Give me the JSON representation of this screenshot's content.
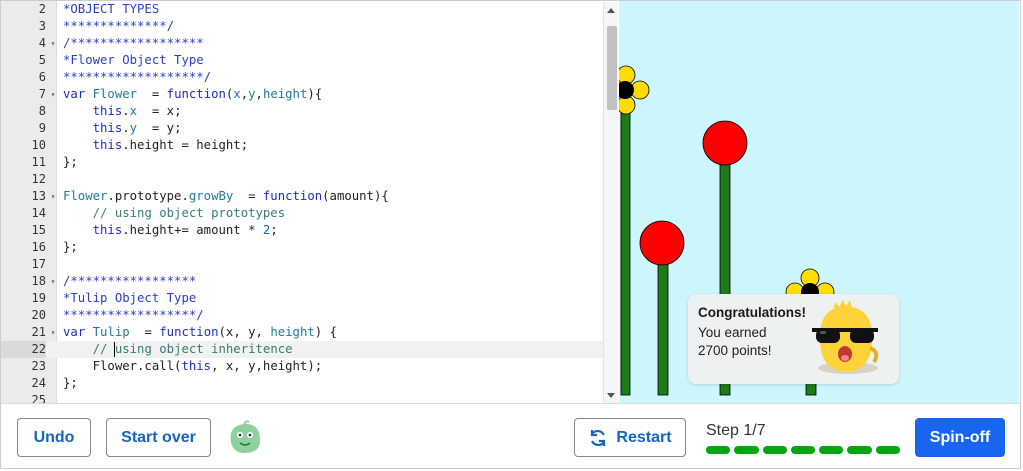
{
  "editor": {
    "lines": [
      {
        "n": "2",
        "fold": false,
        "active": false,
        "segs": [
          [
            "cmt",
            "*OBJECT TYPES"
          ]
        ]
      },
      {
        "n": "3",
        "fold": false,
        "active": false,
        "segs": [
          [
            "cmt",
            "**************/"
          ]
        ]
      },
      {
        "n": "4",
        "fold": true,
        "active": false,
        "segs": [
          [
            "cmt",
            "/******************"
          ]
        ]
      },
      {
        "n": "5",
        "fold": false,
        "active": false,
        "segs": [
          [
            "cmt",
            "*Flower Object Type"
          ]
        ]
      },
      {
        "n": "6",
        "fold": false,
        "active": false,
        "segs": [
          [
            "cmt",
            "*******************/"
          ]
        ]
      },
      {
        "n": "7",
        "fold": true,
        "active": false,
        "segs": [
          [
            "kw",
            "var "
          ],
          [
            "prop",
            "Flower"
          ],
          [
            "",
            "  = "
          ],
          [
            "kw",
            "function"
          ],
          [
            "",
            "("
          ],
          [
            "prop",
            "x"
          ],
          [
            "",
            ","
          ],
          [
            "prop",
            "y"
          ],
          [
            "",
            ","
          ],
          [
            "prop",
            "height"
          ],
          [
            "",
            "){"
          ]
        ]
      },
      {
        "n": "8",
        "fold": false,
        "active": false,
        "segs": [
          [
            "",
            "    "
          ],
          [
            "kw",
            "this"
          ],
          [
            "",
            "."
          ],
          [
            "prop",
            "x"
          ],
          [
            "",
            "  = x;"
          ]
        ]
      },
      {
        "n": "9",
        "fold": false,
        "active": false,
        "segs": [
          [
            "",
            "    "
          ],
          [
            "kw",
            "this"
          ],
          [
            "",
            "."
          ],
          [
            "prop",
            "y"
          ],
          [
            "",
            "  = y;"
          ]
        ]
      },
      {
        "n": "10",
        "fold": false,
        "active": false,
        "segs": [
          [
            "",
            "    "
          ],
          [
            "kw",
            "this"
          ],
          [
            "",
            ".height = height;"
          ]
        ]
      },
      {
        "n": "11",
        "fold": false,
        "active": false,
        "segs": [
          [
            "",
            "};"
          ]
        ]
      },
      {
        "n": "12",
        "fold": false,
        "active": false,
        "segs": [
          [
            "",
            ""
          ]
        ]
      },
      {
        "n": "13",
        "fold": true,
        "active": false,
        "segs": [
          [
            "prop",
            "Flower"
          ],
          [
            "",
            ".prototype."
          ],
          [
            "prop",
            "growBy"
          ],
          [
            "",
            "  = "
          ],
          [
            "kw",
            "function"
          ],
          [
            "",
            "(amount){"
          ]
        ]
      },
      {
        "n": "14",
        "fold": false,
        "active": false,
        "segs": [
          [
            "",
            "    "
          ],
          [
            "cmt2",
            "// using object prototypes"
          ]
        ]
      },
      {
        "n": "15",
        "fold": false,
        "active": false,
        "segs": [
          [
            "",
            "    "
          ],
          [
            "kw",
            "this"
          ],
          [
            "",
            ".height+= amount * "
          ],
          [
            "num",
            "2"
          ],
          [
            "",
            ";"
          ]
        ]
      },
      {
        "n": "16",
        "fold": false,
        "active": false,
        "segs": [
          [
            "",
            "};"
          ]
        ]
      },
      {
        "n": "17",
        "fold": false,
        "active": false,
        "segs": [
          [
            "",
            ""
          ]
        ]
      },
      {
        "n": "18",
        "fold": true,
        "active": false,
        "segs": [
          [
            "cmt",
            "/*****************"
          ]
        ]
      },
      {
        "n": "19",
        "fold": false,
        "active": false,
        "segs": [
          [
            "cmt",
            "*Tulip Object Type"
          ]
        ]
      },
      {
        "n": "20",
        "fold": false,
        "active": false,
        "segs": [
          [
            "cmt",
            "******************/"
          ]
        ]
      },
      {
        "n": "21",
        "fold": true,
        "active": false,
        "segs": [
          [
            "kw",
            "var "
          ],
          [
            "prop",
            "Tulip"
          ],
          [
            "",
            "  = "
          ],
          [
            "kw",
            "function"
          ],
          [
            "",
            "(x, y, "
          ],
          [
            "prop",
            "height"
          ],
          [
            "",
            ") {"
          ]
        ]
      },
      {
        "n": "22",
        "fold": false,
        "active": true,
        "segs": [
          [
            "",
            "    "
          ],
          [
            "cmt2",
            "// "
          ],
          [
            "cursor",
            ""
          ],
          [
            "cmt2",
            "using object inheritence"
          ]
        ]
      },
      {
        "n": "23",
        "fold": false,
        "active": false,
        "segs": [
          [
            "",
            "    Flower.call("
          ],
          [
            "kw",
            "this"
          ],
          [
            "",
            ", x, y,height);"
          ]
        ]
      },
      {
        "n": "24",
        "fold": false,
        "active": false,
        "segs": [
          [
            "",
            "};"
          ]
        ]
      },
      {
        "n": "25",
        "fold": false,
        "active": false,
        "segs": [
          [
            "",
            ""
          ]
        ]
      }
    ]
  },
  "toast": {
    "title": "Congratulations!",
    "line1": "You earned",
    "line2": "2700 points!"
  },
  "toolbar": {
    "undo_label": "Undo",
    "start_over_label": "Start over",
    "restart_label": "Restart",
    "spin_off_label": "Spin-off",
    "step_label": "Step 1/7",
    "progress_total": 7,
    "progress_completed": 7
  },
  "colors": {
    "accent": "#1865f2",
    "progress": "#00a60e",
    "sky": "#ccf6fb",
    "stem": "#1f7a1a",
    "tulip": "#ff0000",
    "sunflower": "#ffdd00"
  }
}
